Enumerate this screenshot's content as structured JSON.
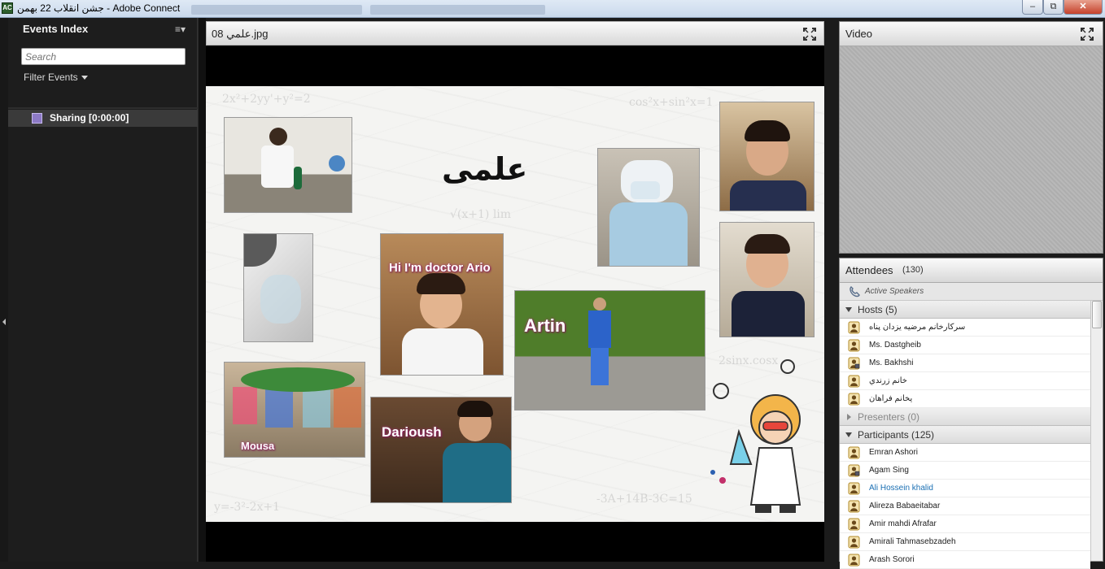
{
  "window": {
    "title": "جشن انقلاب 22 بهمن - Adobe Connect",
    "min_glyph": "–",
    "max_glyph": "⧉",
    "close_glyph": "✕"
  },
  "events": {
    "header": "Events Index",
    "menu_glyph": "≡▾",
    "search_placeholder": "Search",
    "filter_label": "Filter Events",
    "items": [
      {
        "label": "Sharing [0:00:00]"
      }
    ]
  },
  "share": {
    "title": "08 علمي.jpg",
    "slide": {
      "heading": "علمی",
      "captions": {
        "doctor": "Hi I'm doctor Ario",
        "artin": "Artin",
        "mousa": "Mousa",
        "darioush": "Darioush"
      }
    }
  },
  "video": {
    "title": "Video"
  },
  "attendees": {
    "title": "Attendees",
    "count": "(130)",
    "active_speakers": "Active Speakers",
    "groups": {
      "hosts": {
        "label": "Hosts (5)",
        "members": [
          "سرکارخانم مرضیه یزدان پناه",
          "Ms. Dastgheib",
          "Ms. Bakhshi",
          "خانم زرندي",
          "یخانم فراهان"
        ]
      },
      "presenters": {
        "label": "Presenters (0)"
      },
      "participants": {
        "label": "Participants (125)",
        "members": [
          "Emran  Ashori",
          "Agam Sing",
          "Ali Hossein khalid",
          "Alireza Babaeitabar",
          "Amir mahdi Afrafar",
          "Amirali Tahmasebzadeh",
          "Arash Sorori"
        ]
      }
    }
  },
  "colors": {
    "accent_link": "#1a6fb3",
    "caption_glow": "#b0307a"
  },
  "icons": [
    "fullscreen-icon",
    "phone-icon",
    "user-icon",
    "camera-user-icon",
    "sharing-icon"
  ]
}
